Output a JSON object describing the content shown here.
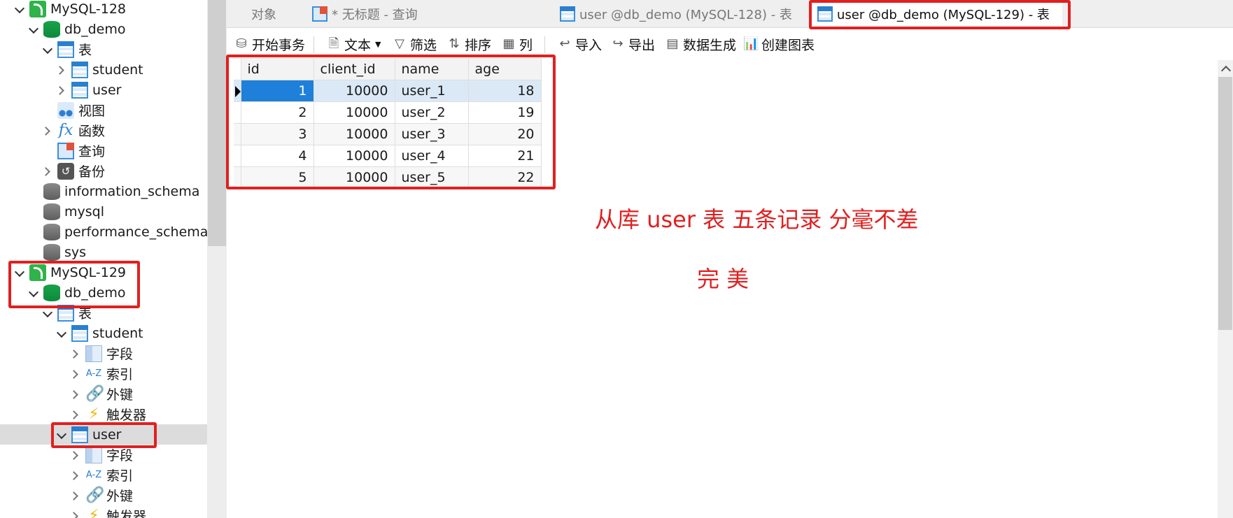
{
  "sidebar": {
    "conn128": "MySQL-128",
    "db128": "db_demo",
    "tables_label": "表",
    "student": "student",
    "user": "user",
    "views": "视图",
    "functions": "函数",
    "queries": "查询",
    "backups": "备份",
    "information_schema": "information_schema",
    "mysql": "mysql",
    "performance_schema": "performance_schema",
    "sys": "sys",
    "conn129": "MySQL-129",
    "db129": "db_demo",
    "tables129": "表",
    "student129": "student",
    "fields": "字段",
    "indexes": "索引",
    "foreign_keys": "外键",
    "triggers": "触发器",
    "user129": "user",
    "fields2": "字段",
    "indexes2": "索引",
    "foreign_keys2": "外键",
    "triggers2": "触发器"
  },
  "tabs": {
    "objects": "对象",
    "untitled_query": "* 无标题 - 查询",
    "user128": "user @db_demo (MySQL-128) - 表",
    "user129": "user @db_demo (MySQL-129) - 表"
  },
  "toolbar": {
    "begin_tx": "开始事务",
    "text": "文本",
    "filter": "筛选",
    "sort": "排序",
    "columns": "列",
    "import": "导入",
    "export": "导出",
    "data_gen": "数据生成",
    "create_chart": "创建图表"
  },
  "grid": {
    "headers": [
      "id",
      "client_id",
      "name",
      "age"
    ],
    "rows": [
      [
        "1",
        "10000",
        "user_1",
        "18"
      ],
      [
        "2",
        "10000",
        "user_2",
        "19"
      ],
      [
        "3",
        "10000",
        "user_3",
        "20"
      ],
      [
        "4",
        "10000",
        "user_4",
        "21"
      ],
      [
        "5",
        "10000",
        "user_5",
        "22"
      ]
    ]
  },
  "annotations": {
    "line1": "从库 user 表 五条记录  分毫不差",
    "line2": "完    美"
  },
  "colors": {
    "annotation_red": "#e02020",
    "selection_blue": "#1e80d8",
    "db_green": "#19a34a"
  }
}
